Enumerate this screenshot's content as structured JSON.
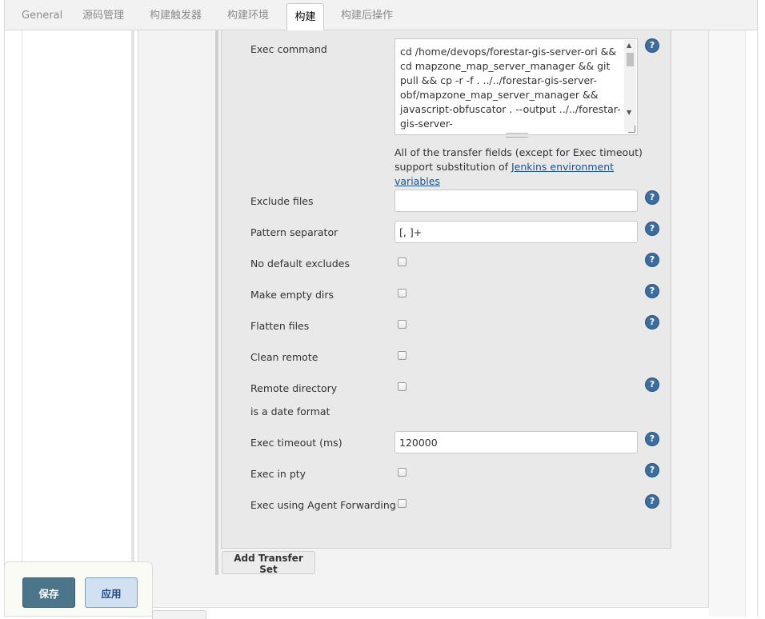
{
  "tabs": [
    {
      "label": "General",
      "active": false
    },
    {
      "label": "源码管理",
      "active": false
    },
    {
      "label": "构建触发器",
      "active": false
    },
    {
      "label": "构建环境",
      "active": false
    },
    {
      "label": "构建",
      "active": true
    },
    {
      "label": "构建后操作",
      "active": false
    }
  ],
  "transfer": {
    "exec_command_label": "Exec command",
    "exec_command_value": "cd /home/devops/forestar-gis-server-ori && cd mapzone_map_server_manager && git pull && cp -r -f . ../../forestar-gis-server-obf/mapzone_map_server_manager && javascript-obfuscator . --output ../../forestar-gis-server-obf/mapzone_map_server_manager --",
    "note_text": "All of the transfer fields (except for Exec timeout) support substitution of",
    "note_link": "Jenkins environment variables",
    "exclude_files_label": "Exclude files",
    "exclude_files_value": "",
    "pattern_separator_label": "Pattern separator",
    "pattern_separator_value": "[, ]+",
    "no_default_excludes_label": "No default excludes",
    "make_empty_dirs_label": "Make empty dirs",
    "flatten_files_label": "Flatten files",
    "clean_remote_label": "Clean remote",
    "remote_directory_label_1": "Remote directory",
    "remote_directory_label_2": "is a date format",
    "exec_timeout_label": "Exec timeout (ms)",
    "exec_timeout_value": "120000",
    "exec_in_pty_label": "Exec in pty",
    "exec_agent_forwarding_label": "Exec using Agent Forwarding",
    "help_glyph": "?",
    "add_transfer_set": "Add Transfer Set"
  },
  "actions": {
    "save": "保存",
    "apply": "应用"
  },
  "colors": {
    "save_bg": "#4b758b",
    "apply_bg": "#d2e1f1",
    "help_icon": "#3d6d9c",
    "link": "#1f4f8a"
  }
}
